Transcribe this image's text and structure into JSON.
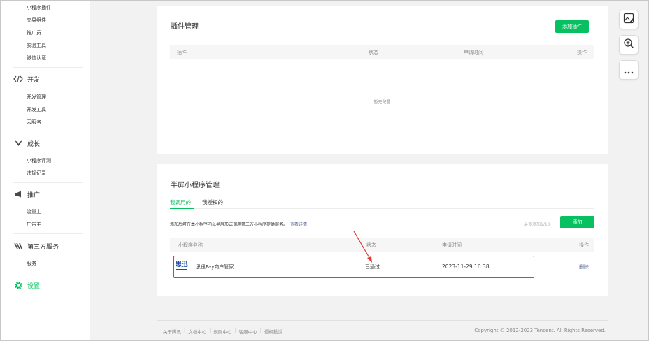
{
  "sidebar": {
    "top_items": [
      "小程序插件",
      "交易组件",
      "推广员",
      "实验工具",
      "微信认证"
    ],
    "groups": [
      {
        "icon": "code-icon",
        "label": "开发",
        "items": [
          "开发管理",
          "开发工具",
          "云服务"
        ]
      },
      {
        "icon": "growth-icon",
        "label": "成长",
        "items": [
          "小程序评测",
          "违规记录"
        ]
      },
      {
        "icon": "megaphone-icon",
        "label": "推广",
        "items": [
          "流量主",
          "广告主"
        ]
      },
      {
        "icon": "third-party-icon",
        "label": "第三方服务",
        "items": [
          "服务"
        ]
      },
      {
        "icon": "gear-icon",
        "label": "设置",
        "items": []
      }
    ]
  },
  "plugin_card": {
    "title": "插件管理",
    "add_button": "添加插件",
    "columns": [
      "插件",
      "状态",
      "申请时间",
      "操作"
    ],
    "empty_text": "暂无配置"
  },
  "half_screen_card": {
    "title": "半屏小程序管理",
    "tabs": [
      "我调用的",
      "我授权的"
    ],
    "description": "添加后可在本小程序内以半屏形式调用第三方小程序提供服务。",
    "detail_link": "查看详情",
    "quota": "最多添加1/10",
    "add_button": "添加",
    "columns": [
      "小程序名称",
      "状态",
      "申请时间",
      "操作"
    ],
    "rows": [
      {
        "logo": "思迅",
        "name": "思迅Pay商户管家",
        "status": "已通过",
        "time": "2023-11-29 16:38",
        "action": "删除"
      }
    ]
  },
  "footer": {
    "links": [
      "关于腾讯",
      "文档中心",
      "规则中心",
      "客服中心",
      "侵权投诉"
    ],
    "copyright": "Copyright © 2012-2023 Tencent. All Rights Reserved."
  },
  "tools": [
    "edit-image-icon",
    "zoom-in-icon",
    "more-icon"
  ],
  "colors": {
    "accent": "#07c160",
    "link": "#576b95",
    "highlight": "#e23b2e"
  }
}
